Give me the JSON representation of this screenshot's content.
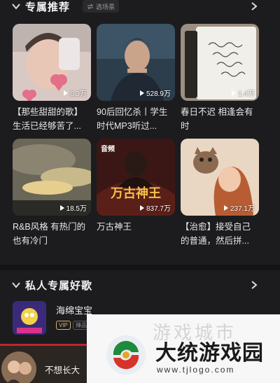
{
  "section1": {
    "title": "专属推荐",
    "scene_tag": "选场景"
  },
  "cards": [
    {
      "play_count": "6.3万",
      "title": "【那些甜甜的歌】生活已经够苦了..."
    },
    {
      "play_count": "528.9万",
      "title": "90后回忆杀丨学生时代MP3听过..."
    },
    {
      "play_count": "1.4万",
      "title": "春日不迟 相逢会有时"
    },
    {
      "play_count": "18.5万",
      "title": "R&B风格 有热门的也有冷门"
    },
    {
      "play_count": "837.7万",
      "title": "万古神王",
      "badge": "音频",
      "cover_text": "万古神王"
    },
    {
      "play_count": "237.1万",
      "title": "【治愈】接受自己的普通，然后拼..."
    }
  ],
  "card3_handwriting": "慢慢来没关系\n慢慢去\n你是你自己\n按时间就会\n有了",
  "section2": {
    "title": "私人专属好歌"
  },
  "song": {
    "title": "海绵宝宝",
    "vip": "VIP",
    "quality": "臻品"
  },
  "player": {
    "title": "不想长大"
  },
  "watermark": {
    "ghost": "游戏城市",
    "name": "大统游戏园",
    "url": "www.tjlogo.com"
  }
}
